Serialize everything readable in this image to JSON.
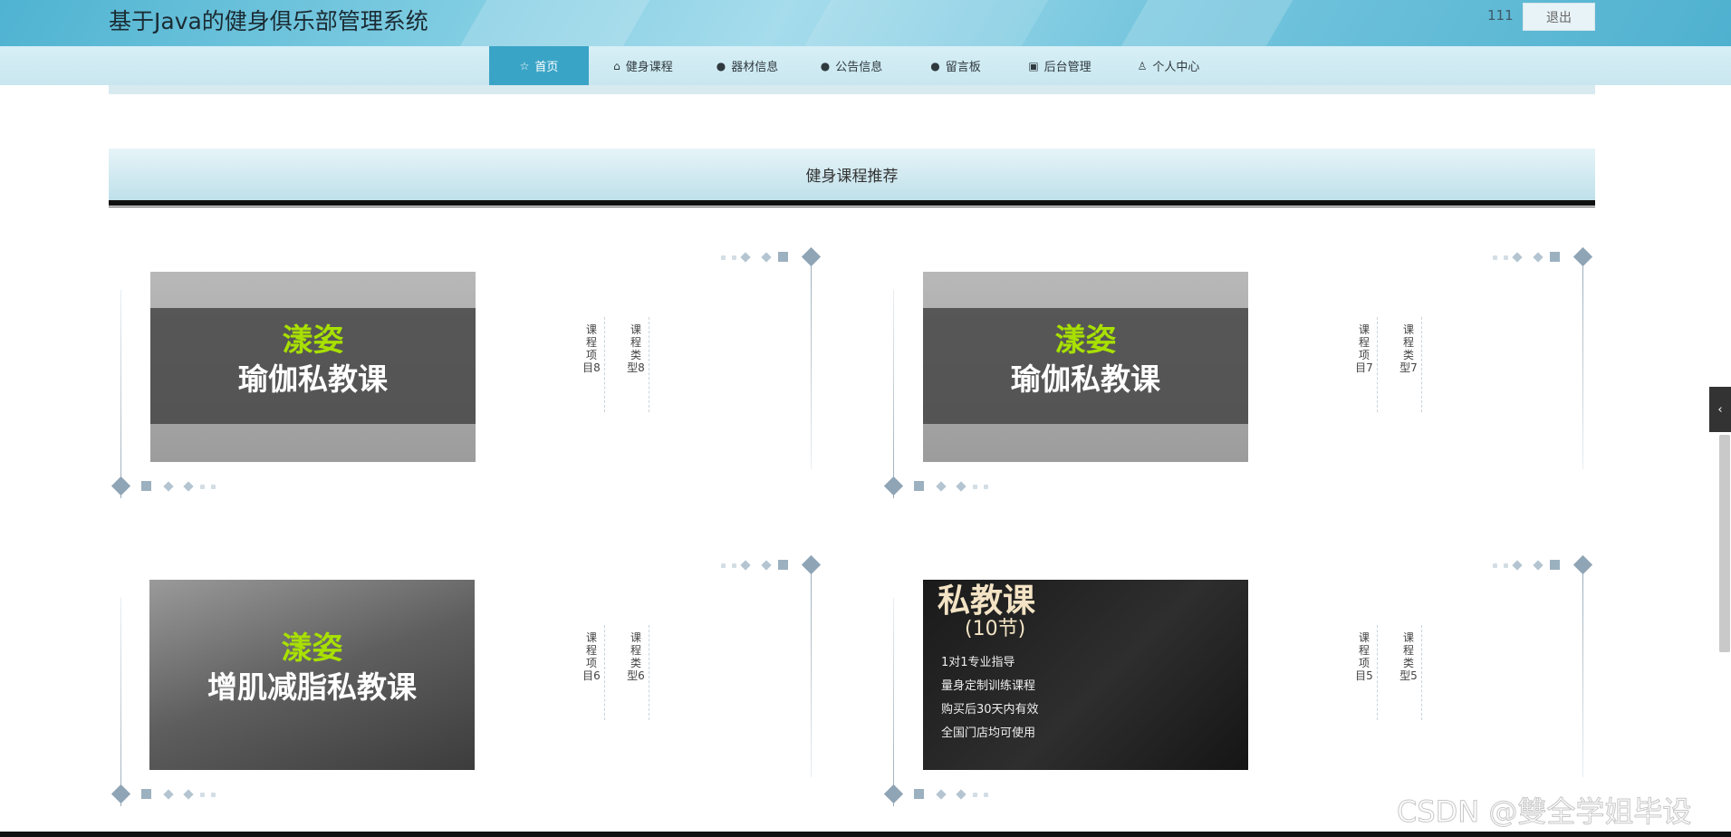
{
  "app": {
    "title": "基于Java的健身俱乐部管理系统",
    "user": "111",
    "logout_label": "退出"
  },
  "nav": [
    {
      "label": "首页",
      "icon": "star-icon",
      "glyph": "☆"
    },
    {
      "label": "健身课程",
      "icon": "bag-icon",
      "glyph": "⌂"
    },
    {
      "label": "器材信息",
      "icon": "alert-icon",
      "glyph": "●"
    },
    {
      "label": "公告信息",
      "icon": "help-icon",
      "glyph": "●"
    },
    {
      "label": "留言板",
      "icon": "info-icon",
      "glyph": "●"
    },
    {
      "label": "后台管理",
      "icon": "box-icon",
      "glyph": "▣"
    },
    {
      "label": "个人中心",
      "icon": "user-icon",
      "glyph": "♙"
    }
  ],
  "section": {
    "title": "健身课程推荐"
  },
  "cards": [
    {
      "brand": "漾姿",
      "course": "瑜伽私教课",
      "project": "课程项目8",
      "type": "课程类型8"
    },
    {
      "brand": "漾姿",
      "course": "瑜伽私教课",
      "project": "课程项目7",
      "type": "课程类型7"
    },
    {
      "brand": "漾姿",
      "course": "增肌减脂私教课",
      "project": "课程项目6",
      "type": "课程类型6"
    },
    {
      "title": "私教课",
      "sub": "(10节)",
      "lines": [
        "1对1专业指导",
        "量身定制训练课程",
        "购买后30天内有效",
        "全国门店均可使用"
      ],
      "project": "课程项目5",
      "type": "课程类型5"
    }
  ],
  "watermark": "CSDN @雙全学姐毕设",
  "sidebar_toggle": "‹"
}
